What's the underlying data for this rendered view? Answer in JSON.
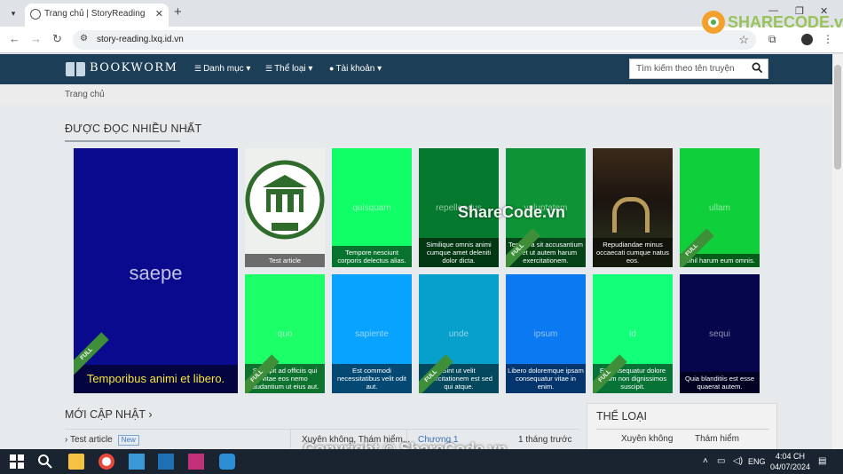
{
  "browser": {
    "tab_title": "Trang chủ | StoryReading",
    "tab_close": "✕",
    "new_tab": "+",
    "url": "story-reading.lxq.id.vn",
    "back": "←",
    "forward": "→",
    "reload": "↻",
    "star": "☆",
    "win_min": "—",
    "win_max": "❐",
    "win_close": "✕"
  },
  "site": {
    "brand": "BOOKWORM",
    "nav": {
      "menu": "Danh mục ▾",
      "genres": "Thể loại ▾",
      "account": "Tài khoản ▾"
    },
    "search_placeholder": "Tìm kiếm theo tên truyện",
    "breadcrumb": "Trang chủ"
  },
  "most_read": {
    "title": "ĐƯỢC ĐỌC NHIỀU NHẤT",
    "featured": {
      "word": "saepe",
      "caption": "Temporibus animi et libero.",
      "full": true,
      "color": "#0a0a8e"
    },
    "cards": [
      {
        "word": "",
        "caption": "Test article",
        "full": false,
        "color": "#eef0ee",
        "image": "hoi-an-logo"
      },
      {
        "word": "quisquam",
        "caption": "Tempore nesciunt corporis delectus alias.",
        "full": false,
        "color": "#11ff66"
      },
      {
        "word": "repellendus",
        "caption": "Similique omnis animi cumque amet deleniti dolor dicta.",
        "full": false,
        "color": "#057a2e"
      },
      {
        "word": "voluptatem",
        "caption": "Tempora sit accusantium ut et ut autem harum exercitationem.",
        "full": true,
        "color": "#0e9436"
      },
      {
        "word": "",
        "caption": "Repudiandae minus occaecati cumque natus eos.",
        "full": false,
        "color": "#222222",
        "image": "temple-photo"
      },
      {
        "word": "ullam",
        "caption": "Nihil harum eum omnis.",
        "full": true,
        "color": "#0fd03a"
      },
      {
        "word": "quo",
        "caption": "Suscipit ad officiis qui vitae eos nemo laudantium ut eius aut.",
        "full": true,
        "color": "#1dff66"
      },
      {
        "word": "sapiente",
        "caption": "Est commodi necessitatibus velit odit aut.",
        "full": false,
        "color": "#08a3ff"
      },
      {
        "word": "unde",
        "caption": "Sint ut velit exercitationem est sed qui atque.",
        "full": true,
        "color": "#07a0cc"
      },
      {
        "word": "ipsum",
        "caption": "Libero doloremque ipsam consequatur vitae in enim.",
        "full": false,
        "color": "#0a79f2"
      },
      {
        "word": "id",
        "caption": "Et consequatur dolore rerum non dignissimos suscipit.",
        "full": true,
        "color": "#12ff7a"
      },
      {
        "word": "sequi",
        "caption": "Quia blanditiis est esse quaerat autem.",
        "full": false,
        "color": "#06064d"
      }
    ],
    "full_label": "FULL"
  },
  "updates": {
    "title": "MỚI CẬP NHẬT",
    "row": {
      "name": "Test article",
      "badge": "New",
      "genres": "Xuyên không, Thám hiểm...",
      "chapter": "Chương 1",
      "time": "1 tháng trước"
    }
  },
  "genres_panel": {
    "title": "THỂ LOẠI",
    "items": [
      "Xuyên không",
      "Thám hiểm"
    ]
  },
  "watermarks": {
    "logo": "SHARECODE.vn",
    "center": "ShareCode.vn",
    "copyright": "Copyright © ShareCode.vn"
  },
  "taskbar": {
    "lang": "ENG",
    "time": "4:04 CH",
    "date": "04/07/2024",
    "notify_count": "2"
  }
}
